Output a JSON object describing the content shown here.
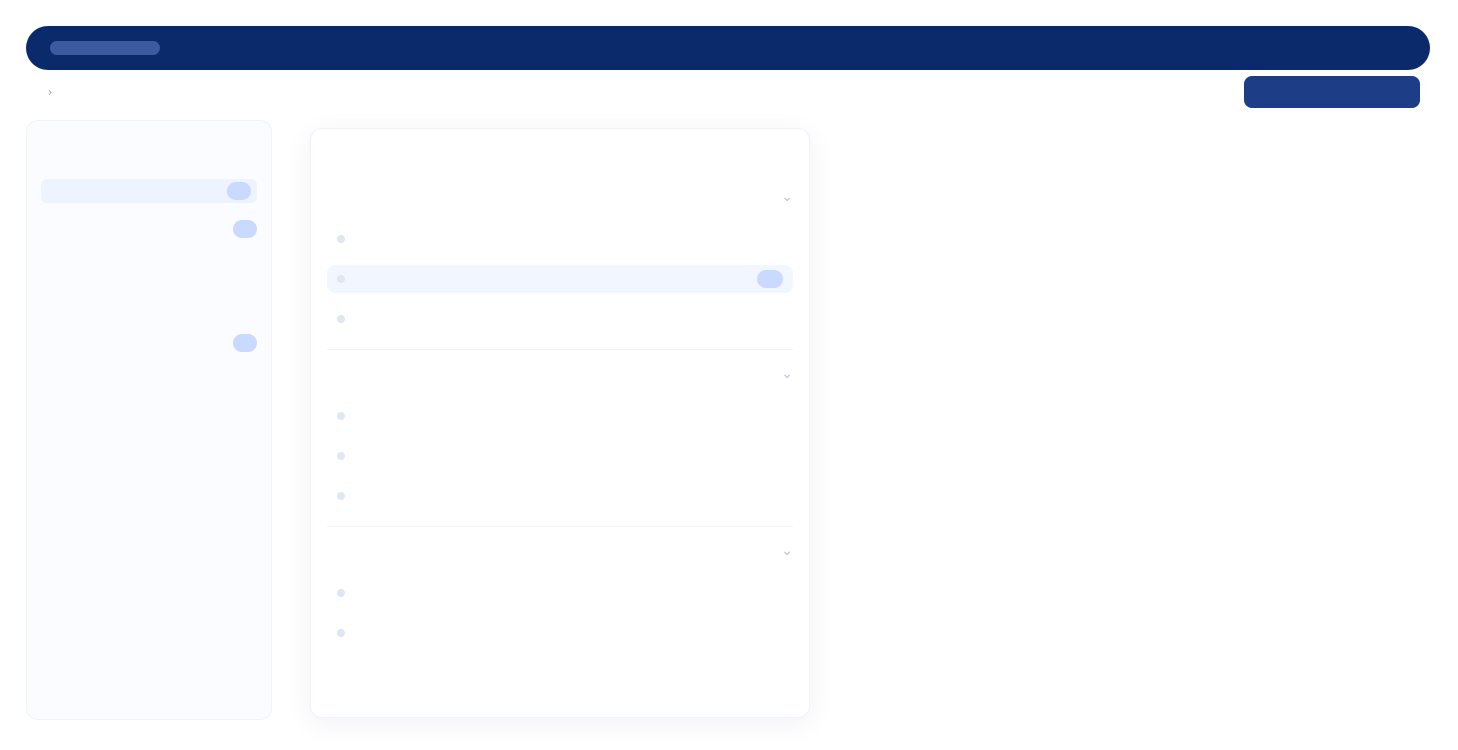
{
  "topbar": {
    "brand": "",
    "nav": [
      "",
      ""
    ]
  },
  "subbar": {
    "breadcrumb": [
      "",
      ""
    ],
    "links": [
      "",
      "",
      ""
    ],
    "primary_button": ""
  },
  "left_panel": {
    "title": "",
    "section_label": "",
    "filters": [
      {
        "label": "",
        "count": "",
        "active": true
      },
      {
        "label": "",
        "count": ""
      },
      {
        "label": "",
        "count": ""
      },
      {
        "label": "",
        "count": ""
      },
      {
        "label": "",
        "count": ""
      }
    ],
    "footer_lines": [
      "",
      ""
    ]
  },
  "center_panel": {
    "title": "",
    "subtitle": "",
    "header_link": "",
    "groups": [
      {
        "title": "",
        "rows": [
          {
            "label": "",
            "count": ""
          },
          {
            "label": "",
            "count": "",
            "selected": true
          },
          {
            "label": "",
            "count": ""
          }
        ]
      },
      {
        "title": "",
        "rows": [
          {
            "label": "",
            "count": ""
          },
          {
            "label": "",
            "count": ""
          },
          {
            "label": "",
            "count": ""
          }
        ]
      },
      {
        "title": "",
        "rows": [
          {
            "label": "",
            "count": ""
          },
          {
            "label": "",
            "count": ""
          }
        ]
      }
    ]
  },
  "colors": {
    "nav_bg": "#0a2a6b",
    "primary": "#1d3d86",
    "accent_warn": "#f3a06e",
    "selection_bg": "#f2f6ff"
  },
  "icons": {
    "chevron": "chevron-down-icon"
  }
}
